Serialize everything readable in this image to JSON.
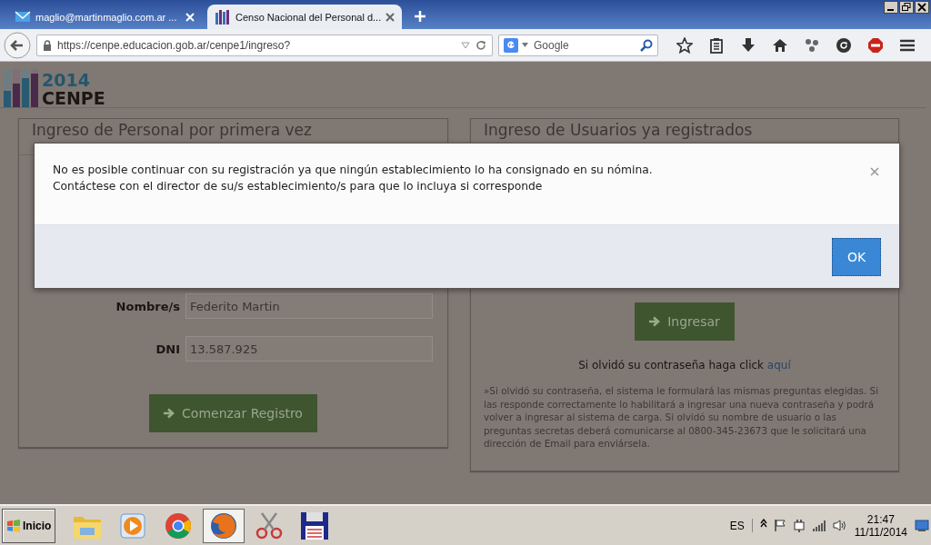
{
  "browser": {
    "tabs": [
      {
        "title": "maglio@martinmaglio.com.ar ...",
        "selected": false,
        "kind": "mail"
      },
      {
        "title": "Censo Nacional del Personal d...",
        "selected": true,
        "kind": "chart"
      }
    ],
    "url": "https://cenpe.educacion.gob.ar/cenpe1/ingreso?",
    "search": {
      "placeholder": "Google"
    }
  },
  "logo": {
    "year": "2014",
    "name": "CENPE"
  },
  "panels": [
    {
      "kind": "form",
      "title": "Ingreso de Personal por primera vez",
      "fields": [
        {
          "label": "Nombre/s",
          "value": "Federito Martin"
        },
        {
          "label": "DNI",
          "value": "13.587.925"
        }
      ],
      "button": "Comenzar Registro"
    },
    {
      "kind": "login",
      "title": "Ingreso de Usuarios ya registrados",
      "button": "Ingresar",
      "forgot": {
        "text": "Si olvidó su contraseña haga click",
        "link": "aquí"
      },
      "note": "»Si olvidó su contraseña, el sistema le formulará las mismas preguntas elegidas. Si las responde correctamente lo habilitará a ingresar una nueva contraseña y podrá volver a ingresar al sistema de carga. Si olvidó su nombre de usuario o las preguntas secretas deberá comunicarse al 0800-345-23673 que le solicitará una dirección de Email para enviársela."
    }
  ],
  "modal": {
    "lines": [
      "No es posible continuar con su registración ya que ningún establecimiento lo ha consignado en su nómina.",
      "Contáctese con el director de su/s establecimiento/s para que lo incluya si corresponde"
    ],
    "button": "OK"
  },
  "taskbar": {
    "start": "Inicio",
    "apps": [
      {
        "kind": "folder",
        "selected": false
      },
      {
        "kind": "media",
        "selected": false
      },
      {
        "kind": "globe",
        "selected": false
      },
      {
        "kind": "fox",
        "selected": true
      },
      {
        "kind": "scissors",
        "selected": false
      },
      {
        "kind": "floppy",
        "selected": false
      }
    ],
    "language": "ES",
    "time": "21:47",
    "date": "11/11/2014"
  }
}
